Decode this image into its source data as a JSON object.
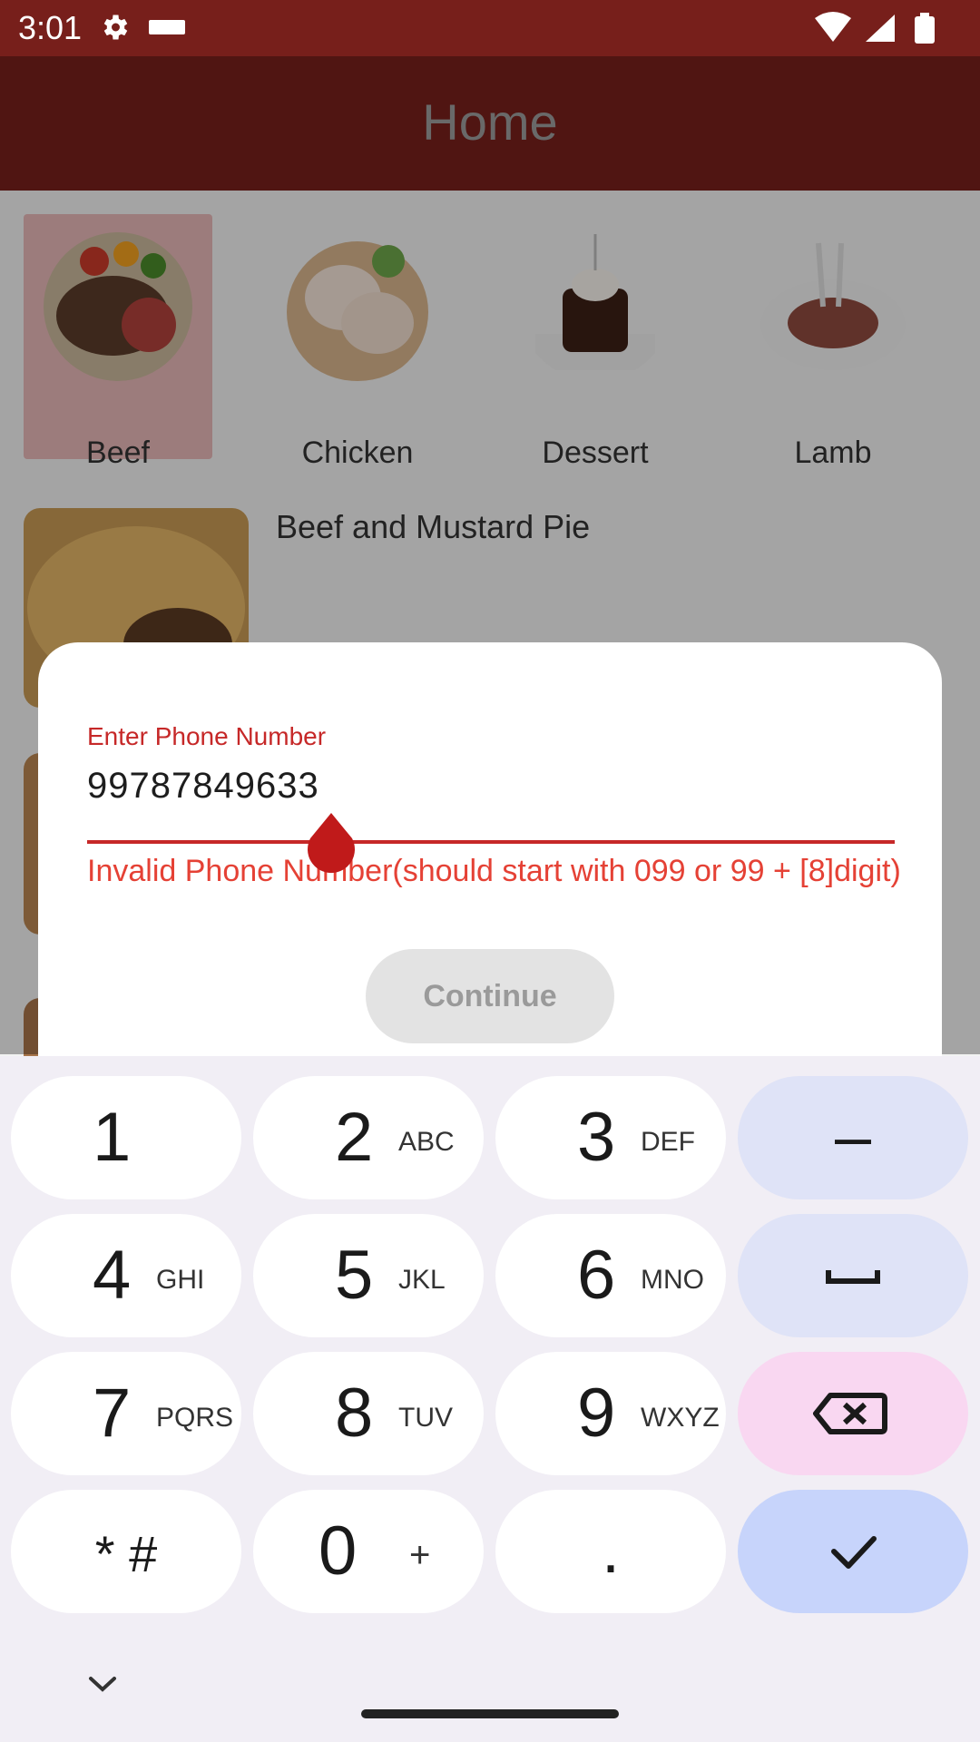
{
  "status_bar": {
    "time": "3:01"
  },
  "app_bar": {
    "title": "Home"
  },
  "categories": [
    {
      "label": "Beef"
    },
    {
      "label": "Chicken"
    },
    {
      "label": "Dessert"
    },
    {
      "label": "Lamb"
    }
  ],
  "recipes": [
    {
      "title": "Beef and Mustard Pie"
    }
  ],
  "dialog": {
    "field_label": "Enter Phone Number",
    "field_value": "99787849633",
    "error": "Invalid Phone Number(should start with 099 or 99 + [8]digit)",
    "continue_label": "Continue"
  },
  "keyboard": {
    "keys": [
      {
        "digit": "1",
        "letters": ""
      },
      {
        "digit": "2",
        "letters": "ABC"
      },
      {
        "digit": "3",
        "letters": "DEF"
      },
      {
        "digit": "4",
        "letters": "GHI"
      },
      {
        "digit": "5",
        "letters": "JKL"
      },
      {
        "digit": "6",
        "letters": "MNO"
      },
      {
        "digit": "7",
        "letters": "PQRS"
      },
      {
        "digit": "8",
        "letters": "TUV"
      },
      {
        "digit": "9",
        "letters": "WXYZ"
      },
      {
        "digit": "0",
        "letters": "+"
      }
    ],
    "star_hash": "* #",
    "dot": ".",
    "dash": "–"
  },
  "colors": {
    "primary": "#771f1b",
    "error": "#e54135",
    "keyboard_bg": "#f1eef5"
  }
}
